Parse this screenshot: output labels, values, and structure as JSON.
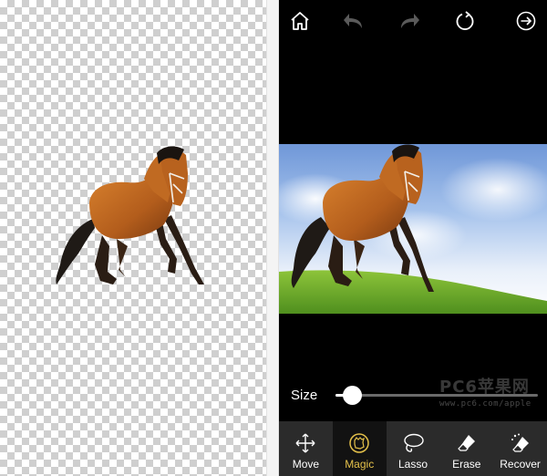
{
  "toolbar_top": {
    "home_icon": "home-icon",
    "undo_icon": "undo-icon",
    "redo_icon": "redo-icon",
    "reset_icon": "reset-icon",
    "next_icon": "next-arrow-icon"
  },
  "size": {
    "label": "Size",
    "value_fraction": 0.08
  },
  "watermark": {
    "title": "PC6苹果网",
    "url": "www.pc6.com/apple"
  },
  "tools": [
    {
      "label": "Move",
      "icon": "move-icon",
      "active": false
    },
    {
      "label": "Magic",
      "icon": "magic-icon",
      "active": true
    },
    {
      "label": "Lasso",
      "icon": "lasso-icon",
      "active": false
    },
    {
      "label": "Erase",
      "icon": "erase-icon",
      "active": false
    },
    {
      "label": "Recover",
      "icon": "recover-icon",
      "active": false
    }
  ],
  "colors": {
    "accent": "#e3c04a",
    "toolbar_bg": "#2b2b2b",
    "screen_bg": "#000000"
  }
}
